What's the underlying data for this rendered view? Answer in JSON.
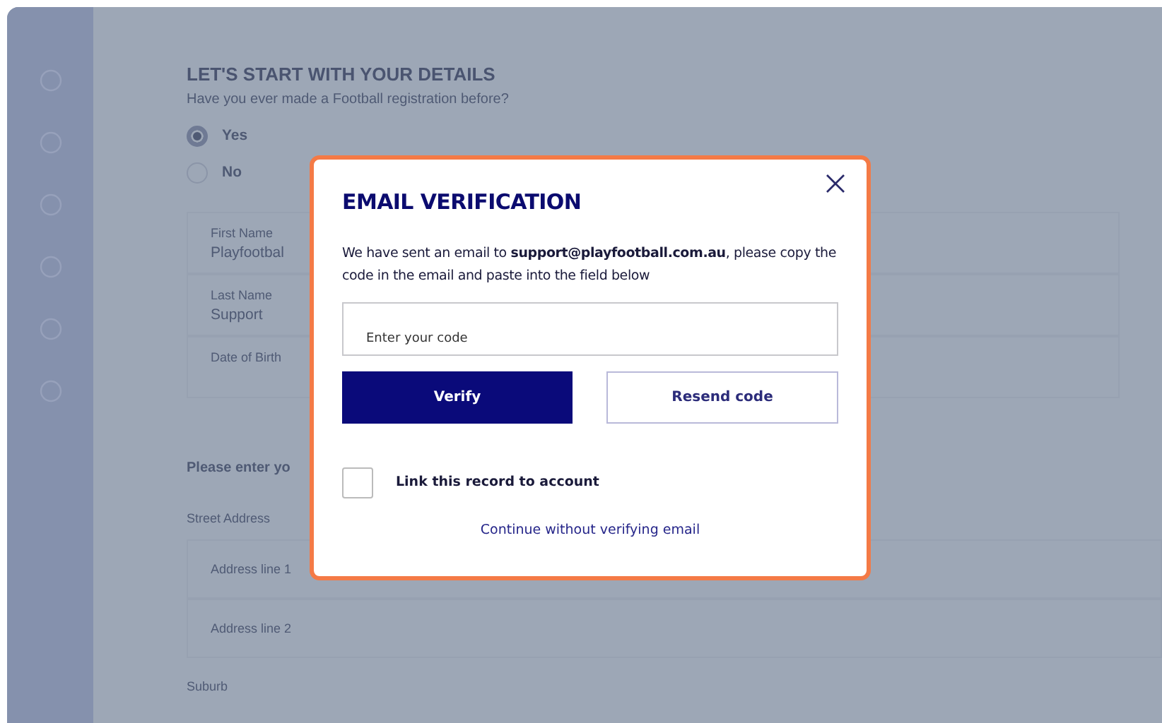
{
  "sidebar": {
    "steps": [
      {
        "done": false
      },
      {
        "done": false
      },
      {
        "done": false
      },
      {
        "done": false
      },
      {
        "done": false
      },
      {
        "done": false
      }
    ]
  },
  "form": {
    "heading": "LET'S START WITH YOUR DETAILS",
    "question": "Have you ever made a Football registration before?",
    "options": [
      {
        "label": "Yes",
        "selected": true
      },
      {
        "label": "No",
        "selected": false
      }
    ],
    "fields": [
      {
        "label": "First Name",
        "value": "Playfootbal"
      },
      {
        "label": "Last Name",
        "value": "Support"
      },
      {
        "label": "Date of Birth"
      }
    ],
    "address_prompt": "Please enter yo",
    "street_label": "Street Address",
    "address_placeholders": [
      "Address line 1",
      "Address line 2"
    ],
    "suburb_label": "Suburb"
  },
  "modal": {
    "title": "EMAIL VERIFICATION",
    "message": "We have sent an email to **support@playfootball.com.au**, please copy the code in the email and paste into the field below",
    "code_placeholder": "Enter your code",
    "verify": "Verify",
    "resend": "Resend code",
    "link_record": {
      "label": "Link this record to account",
      "checked": false
    },
    "continue_link": "Continue without verifying email"
  }
}
